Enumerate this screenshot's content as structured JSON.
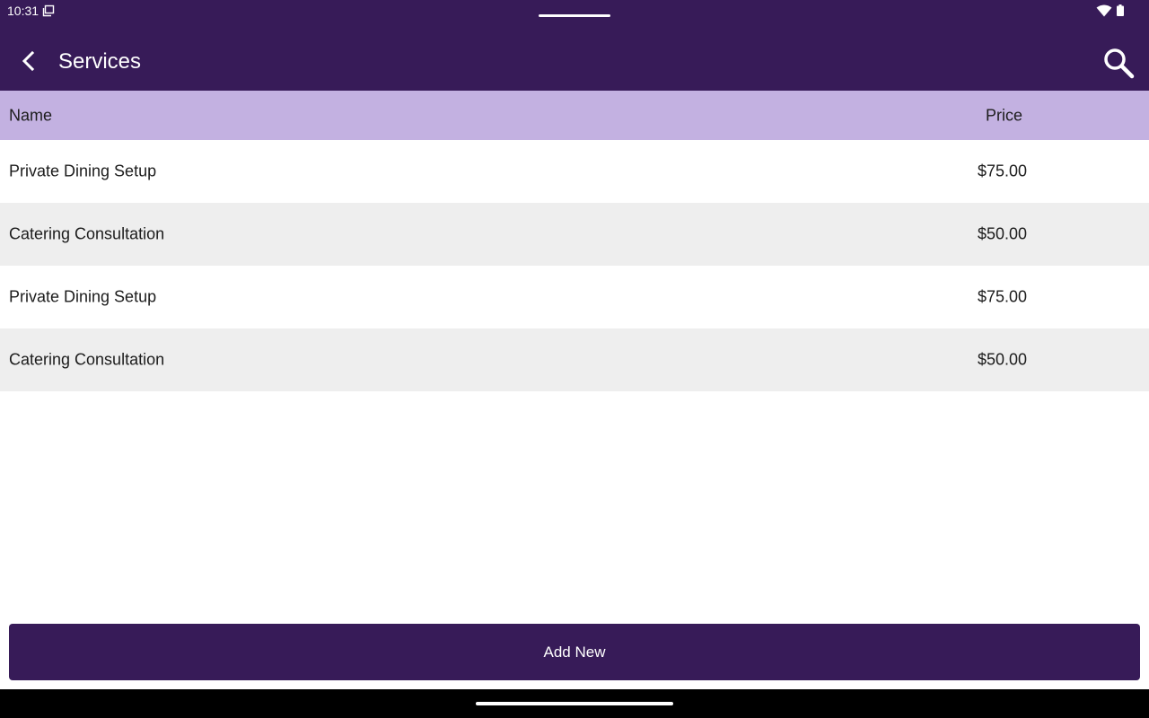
{
  "status_bar": {
    "time": "10:31",
    "icons": [
      "screen-icon",
      "wifi-icon",
      "battery-icon"
    ]
  },
  "app_bar": {
    "title": "Services",
    "back_icon": "back-arrow-icon",
    "search_icon": "search-icon"
  },
  "table": {
    "columns": [
      "Name",
      "Price"
    ],
    "rows": [
      {
        "name": "Private Dining Setup",
        "price": "$75.00"
      },
      {
        "name": "Catering Consultation",
        "price": "$50.00"
      },
      {
        "name": "Private Dining Setup",
        "price": "$75.00"
      },
      {
        "name": "Catering Consultation",
        "price": "$50.00"
      }
    ]
  },
  "actions": {
    "add_new_label": "Add New"
  },
  "colors": {
    "primary": "#371b58",
    "header_bg": "#c3b1e1",
    "row_alt_bg": "#eeeeee",
    "text": "#1c1c1c"
  }
}
